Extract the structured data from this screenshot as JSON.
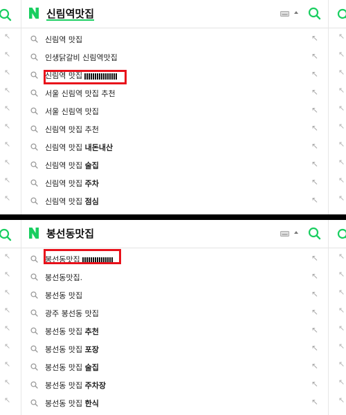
{
  "top": {
    "query": "신림역맛집",
    "items": [
      {
        "text": "신림역 맛집",
        "bold": ""
      },
      {
        "text": "인생닭갈비 신림역맛집",
        "bold": ""
      },
      {
        "text": "신림역 맛집",
        "bold": ""
      },
      {
        "text": "서울 신림역 맛집 추천",
        "bold": ""
      },
      {
        "text": "서울 신림역 맛집",
        "bold": ""
      },
      {
        "text": "신림역 맛집 추천",
        "bold": ""
      },
      {
        "text": "신림역 맛집 ",
        "bold": "내돈내산"
      },
      {
        "text": "신림역 맛집 ",
        "bold": "술집"
      },
      {
        "text": "신림역 맛집 ",
        "bold": "주차"
      },
      {
        "text": "신림역 맛집 ",
        "bold": "점심"
      }
    ]
  },
  "bottom": {
    "query": "봉선동맛집",
    "items": [
      {
        "text": "봉선동맛집",
        "bold": ""
      },
      {
        "text": "봉선동맛집.",
        "bold": ""
      },
      {
        "text": "봉선동 맛집",
        "bold": ""
      },
      {
        "text": "광주 봉선동 맛집",
        "bold": ""
      },
      {
        "text": "봉선동 맛집 ",
        "bold": "추천"
      },
      {
        "text": "봉선동 맛집 ",
        "bold": "포장"
      },
      {
        "text": "봉선동 맛집 ",
        "bold": "술집"
      },
      {
        "text": "봉선동 맛집 ",
        "bold": "주차장"
      },
      {
        "text": "봉선동 맛집 ",
        "bold": "한식"
      }
    ]
  },
  "icons": {
    "logo": "naver-n-logo",
    "search": "magnifier-icon",
    "keyboard": "keyboard-icon",
    "caret": "caret-up-icon",
    "arrow": "arrow-up-left-icon"
  },
  "arrow_glyph": "↖",
  "colors": {
    "brand": "#19ce60",
    "highlight": "#e8101a",
    "text": "#222222",
    "muted": "#a8a8a8"
  }
}
